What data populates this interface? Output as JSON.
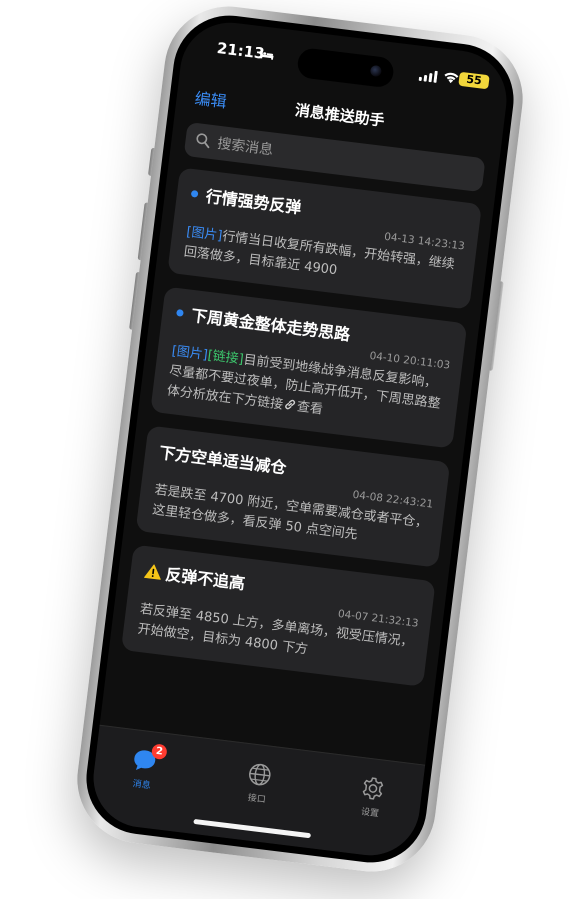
{
  "status_bar": {
    "time": "21:13",
    "battery": "55"
  },
  "nav": {
    "edit_label": "编辑",
    "title": "消息推送助手"
  },
  "search": {
    "placeholder": "搜索消息"
  },
  "messages": [
    {
      "title": "行情强势反弹",
      "unread": true,
      "time": "04-13 14:23:13",
      "tag_image": "[图片]",
      "body": "行情当日收复所有跌幅，开始转强，继续回落做多，目标靠近 4900"
    },
    {
      "title": "下周黄金整体走势思路",
      "unread": true,
      "time": "04-10 20:11:03",
      "tag_image": "[图片]",
      "tag_link": "[链接]",
      "body": "目前受到地缘战争消息反复影响，尽量都不要过夜单，防止高开低开，下周思路整体分析放在下方链接",
      "link_text": "查看"
    },
    {
      "title": "下方空单适当减仓",
      "unread": false,
      "time": "04-08 22:43:21",
      "body": "若是跌至 4700 附近，空单需要减仓或者平仓，这里轻仓做多，看反弹 50 点空间先"
    },
    {
      "title": "反弹不追高",
      "unread": false,
      "warning": true,
      "time": "04-07 21:32:13",
      "body": "若反弹至 4850 上方，多单离场，视受压情况，开始做空，目标为 4800 下方"
    }
  ],
  "tabbar": {
    "items": [
      {
        "label": "消息",
        "icon": "chat-bubble-icon",
        "active": true,
        "badge": "2"
      },
      {
        "label": "接口",
        "icon": "globe-icon",
        "active": false
      },
      {
        "label": "设置",
        "icon": "gear-icon",
        "active": false
      }
    ]
  },
  "colors": {
    "accent": "#2f86f0",
    "background": "#0f0f0f",
    "card": "#252527",
    "badge": "#ff3b30",
    "link_tag": "#3cc66c",
    "battery": "#f2d73b"
  }
}
